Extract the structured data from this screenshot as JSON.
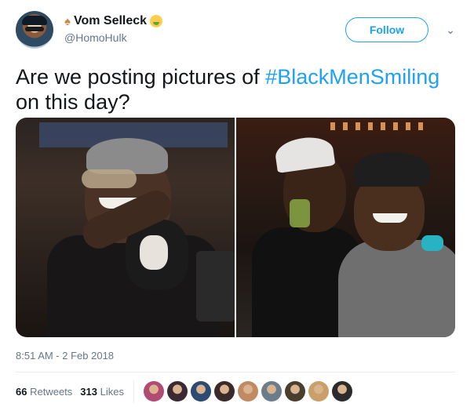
{
  "user": {
    "display_name": "Vom Selleck",
    "handle": "@HomoHulk",
    "emoji_left": "baby-emoji",
    "emoji_right": "nauseated-face-emoji"
  },
  "actions": {
    "follow_label": "Follow",
    "menu_icon": "chevron-down-icon"
  },
  "tweet": {
    "text_before": "Are we posting pictures of ",
    "hashtag": "#BlackMenSmiling",
    "text_after": " on this day?",
    "timestamp": "8:51 AM - 2 Feb 2018"
  },
  "stats": {
    "retweets_count": "66",
    "retweets_label": "Retweets",
    "likes_count": "313",
    "likes_label": "Likes"
  },
  "colors": {
    "accent": "#1da1f2",
    "secondary_text": "#657786",
    "primary_text": "#14171a",
    "divider": "#e6ecf0"
  },
  "liker_avatars": [
    {
      "name": "liker-avatar-1",
      "color": "#b14b73"
    },
    {
      "name": "liker-avatar-2",
      "color": "#3b2a33"
    },
    {
      "name": "liker-avatar-3",
      "color": "#2c4a74"
    },
    {
      "name": "liker-avatar-4",
      "color": "#3a2a2a"
    },
    {
      "name": "liker-avatar-5",
      "color": "#c08b62"
    },
    {
      "name": "liker-avatar-6",
      "color": "#6b7d8a"
    },
    {
      "name": "liker-avatar-7",
      "color": "#4a3f2f"
    },
    {
      "name": "liker-avatar-8",
      "color": "#caa06a"
    },
    {
      "name": "liker-avatar-9",
      "color": "#2b2b2b"
    }
  ]
}
